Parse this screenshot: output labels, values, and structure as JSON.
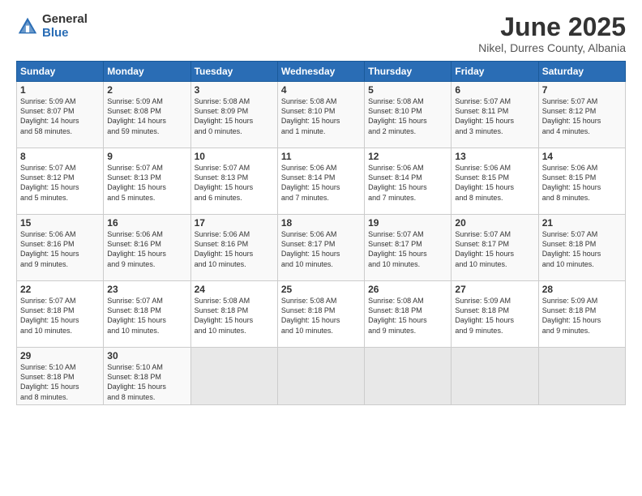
{
  "logo": {
    "general": "General",
    "blue": "Blue"
  },
  "title": "June 2025",
  "subtitle": "Nikel, Durres County, Albania",
  "days_of_week": [
    "Sunday",
    "Monday",
    "Tuesday",
    "Wednesday",
    "Thursday",
    "Friday",
    "Saturday"
  ],
  "weeks": [
    [
      {
        "day": "1",
        "info": "Sunrise: 5:09 AM\nSunset: 8:07 PM\nDaylight: 14 hours\nand 58 minutes."
      },
      {
        "day": "2",
        "info": "Sunrise: 5:09 AM\nSunset: 8:08 PM\nDaylight: 14 hours\nand 59 minutes."
      },
      {
        "day": "3",
        "info": "Sunrise: 5:08 AM\nSunset: 8:09 PM\nDaylight: 15 hours\nand 0 minutes."
      },
      {
        "day": "4",
        "info": "Sunrise: 5:08 AM\nSunset: 8:10 PM\nDaylight: 15 hours\nand 1 minute."
      },
      {
        "day": "5",
        "info": "Sunrise: 5:08 AM\nSunset: 8:10 PM\nDaylight: 15 hours\nand 2 minutes."
      },
      {
        "day": "6",
        "info": "Sunrise: 5:07 AM\nSunset: 8:11 PM\nDaylight: 15 hours\nand 3 minutes."
      },
      {
        "day": "7",
        "info": "Sunrise: 5:07 AM\nSunset: 8:12 PM\nDaylight: 15 hours\nand 4 minutes."
      }
    ],
    [
      {
        "day": "8",
        "info": "Sunrise: 5:07 AM\nSunset: 8:12 PM\nDaylight: 15 hours\nand 5 minutes."
      },
      {
        "day": "9",
        "info": "Sunrise: 5:07 AM\nSunset: 8:13 PM\nDaylight: 15 hours\nand 5 minutes."
      },
      {
        "day": "10",
        "info": "Sunrise: 5:07 AM\nSunset: 8:13 PM\nDaylight: 15 hours\nand 6 minutes."
      },
      {
        "day": "11",
        "info": "Sunrise: 5:06 AM\nSunset: 8:14 PM\nDaylight: 15 hours\nand 7 minutes."
      },
      {
        "day": "12",
        "info": "Sunrise: 5:06 AM\nSunset: 8:14 PM\nDaylight: 15 hours\nand 7 minutes."
      },
      {
        "day": "13",
        "info": "Sunrise: 5:06 AM\nSunset: 8:15 PM\nDaylight: 15 hours\nand 8 minutes."
      },
      {
        "day": "14",
        "info": "Sunrise: 5:06 AM\nSunset: 8:15 PM\nDaylight: 15 hours\nand 8 minutes."
      }
    ],
    [
      {
        "day": "15",
        "info": "Sunrise: 5:06 AM\nSunset: 8:16 PM\nDaylight: 15 hours\nand 9 minutes."
      },
      {
        "day": "16",
        "info": "Sunrise: 5:06 AM\nSunset: 8:16 PM\nDaylight: 15 hours\nand 9 minutes."
      },
      {
        "day": "17",
        "info": "Sunrise: 5:06 AM\nSunset: 8:16 PM\nDaylight: 15 hours\nand 10 minutes."
      },
      {
        "day": "18",
        "info": "Sunrise: 5:06 AM\nSunset: 8:17 PM\nDaylight: 15 hours\nand 10 minutes."
      },
      {
        "day": "19",
        "info": "Sunrise: 5:07 AM\nSunset: 8:17 PM\nDaylight: 15 hours\nand 10 minutes."
      },
      {
        "day": "20",
        "info": "Sunrise: 5:07 AM\nSunset: 8:17 PM\nDaylight: 15 hours\nand 10 minutes."
      },
      {
        "day": "21",
        "info": "Sunrise: 5:07 AM\nSunset: 8:18 PM\nDaylight: 15 hours\nand 10 minutes."
      }
    ],
    [
      {
        "day": "22",
        "info": "Sunrise: 5:07 AM\nSunset: 8:18 PM\nDaylight: 15 hours\nand 10 minutes."
      },
      {
        "day": "23",
        "info": "Sunrise: 5:07 AM\nSunset: 8:18 PM\nDaylight: 15 hours\nand 10 minutes."
      },
      {
        "day": "24",
        "info": "Sunrise: 5:08 AM\nSunset: 8:18 PM\nDaylight: 15 hours\nand 10 minutes."
      },
      {
        "day": "25",
        "info": "Sunrise: 5:08 AM\nSunset: 8:18 PM\nDaylight: 15 hours\nand 10 minutes."
      },
      {
        "day": "26",
        "info": "Sunrise: 5:08 AM\nSunset: 8:18 PM\nDaylight: 15 hours\nand 9 minutes."
      },
      {
        "day": "27",
        "info": "Sunrise: 5:09 AM\nSunset: 8:18 PM\nDaylight: 15 hours\nand 9 minutes."
      },
      {
        "day": "28",
        "info": "Sunrise: 5:09 AM\nSunset: 8:18 PM\nDaylight: 15 hours\nand 9 minutes."
      }
    ],
    [
      {
        "day": "29",
        "info": "Sunrise: 5:10 AM\nSunset: 8:18 PM\nDaylight: 15 hours\nand 8 minutes."
      },
      {
        "day": "30",
        "info": "Sunrise: 5:10 AM\nSunset: 8:18 PM\nDaylight: 15 hours\nand 8 minutes."
      },
      {
        "day": "",
        "info": ""
      },
      {
        "day": "",
        "info": ""
      },
      {
        "day": "",
        "info": ""
      },
      {
        "day": "",
        "info": ""
      },
      {
        "day": "",
        "info": ""
      }
    ]
  ]
}
